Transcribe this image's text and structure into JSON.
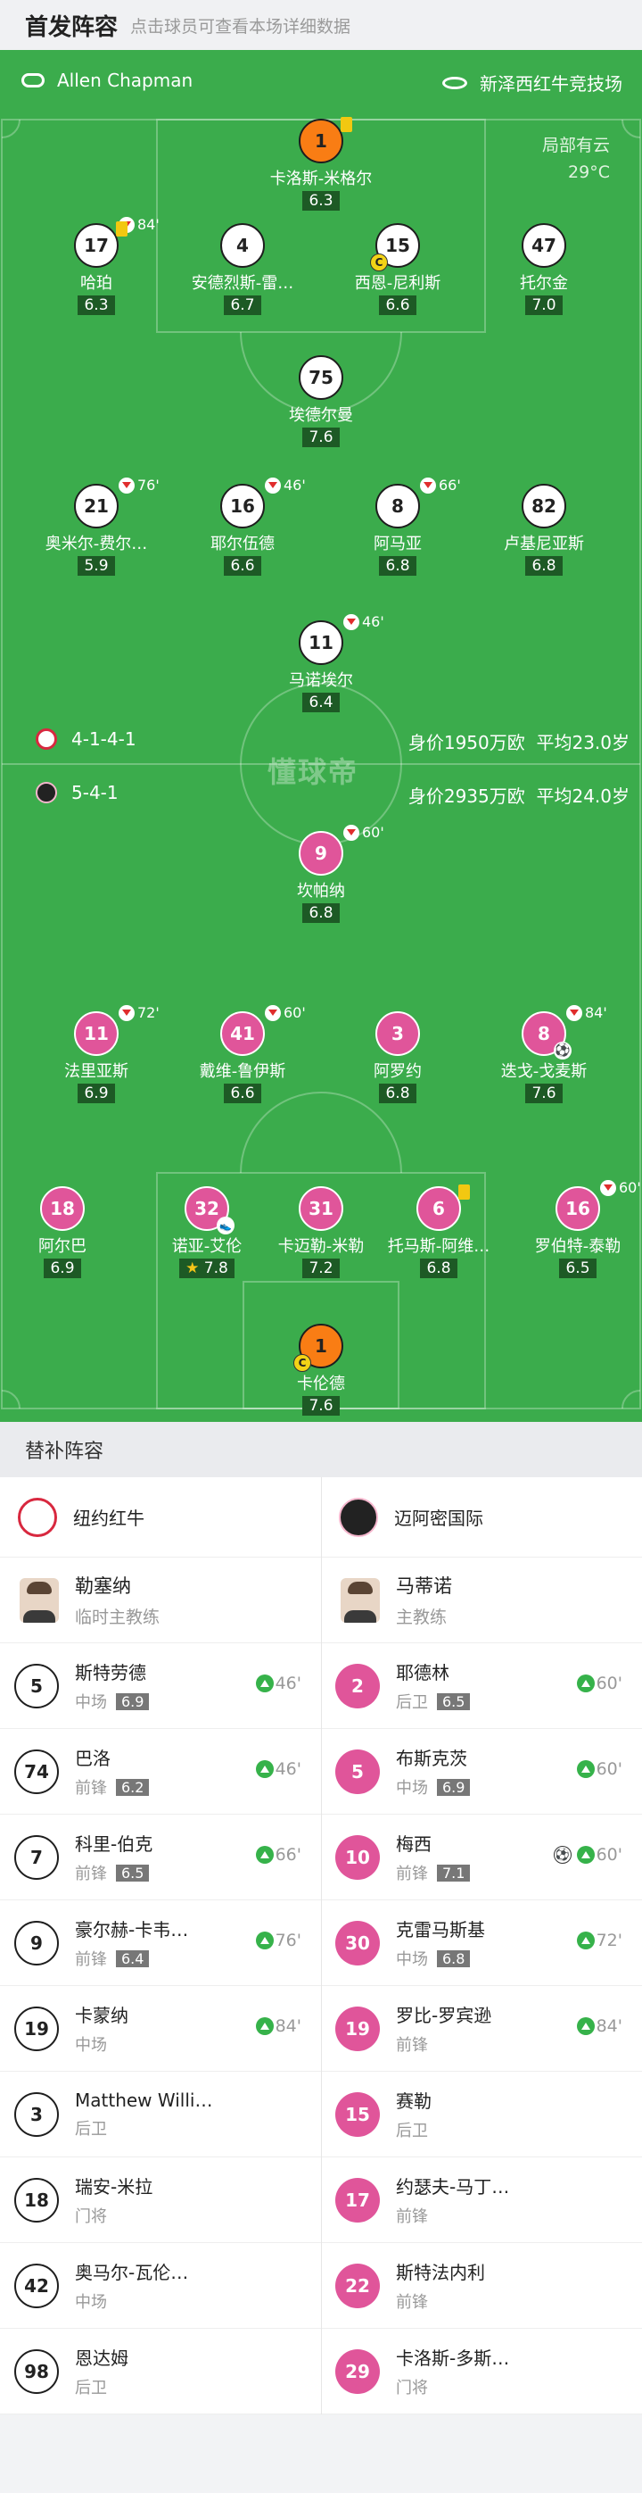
{
  "header": {
    "title": "首发阵容",
    "hint": "点击球员可查看本场详细数据"
  },
  "match": {
    "referee": "Allen Chapman",
    "venue": "新泽西红牛竞技场",
    "weather": "局部有云",
    "temperature": "29°C",
    "watermark": "懂球帝"
  },
  "teams": {
    "home": {
      "name": "纽约红牛",
      "formation": "4-1-4-1",
      "value": "身价1950万欧",
      "avg_age": "平均23.0岁",
      "color": "#ffffff"
    },
    "away": {
      "name": "迈阿密国际",
      "formation": "5-4-1",
      "value": "身价2935万欧",
      "avg_age": "平均24.0岁",
      "color": "#e0559a"
    }
  },
  "home_players": [
    {
      "num": "1",
      "name": "卡洛斯-米格尔",
      "rating": "6.3",
      "style": "o",
      "yellow": true
    },
    {
      "num": "17",
      "name": "哈珀",
      "rating": "6.3",
      "style": "w",
      "yellow": true,
      "sub_out": "84'"
    },
    {
      "num": "4",
      "name": "安德烈斯-雷…",
      "rating": "6.7",
      "style": "w"
    },
    {
      "num": "15",
      "name": "西恩-尼利斯",
      "rating": "6.6",
      "style": "w",
      "captain": true
    },
    {
      "num": "47",
      "name": "托尔金",
      "rating": "7.0",
      "style": "w"
    },
    {
      "num": "75",
      "name": "埃德尔曼",
      "rating": "7.6",
      "style": "w"
    },
    {
      "num": "21",
      "name": "奥米尔-费尔…",
      "rating": "5.9",
      "style": "w",
      "sub_out": "76'"
    },
    {
      "num": "16",
      "name": "耶尔伍德",
      "rating": "6.6",
      "style": "w",
      "sub_out": "46'"
    },
    {
      "num": "8",
      "name": "阿马亚",
      "rating": "6.8",
      "style": "w",
      "sub_out": "66'"
    },
    {
      "num": "82",
      "name": "卢基尼亚斯",
      "rating": "6.8",
      "style": "w"
    },
    {
      "num": "11",
      "name": "马诺埃尔",
      "rating": "6.4",
      "style": "w",
      "sub_out": "46'"
    }
  ],
  "away_players": [
    {
      "num": "9",
      "name": "坎帕纳",
      "rating": "6.8",
      "style": "p",
      "sub_out": "60'"
    },
    {
      "num": "11",
      "name": "法里亚斯",
      "rating": "6.9",
      "style": "p",
      "sub_out": "72'"
    },
    {
      "num": "41",
      "name": "戴维-鲁伊斯",
      "rating": "6.6",
      "style": "p",
      "sub_out": "60'"
    },
    {
      "num": "3",
      "name": "阿罗约",
      "rating": "6.8",
      "style": "p"
    },
    {
      "num": "8",
      "name": "迭戈-戈麦斯",
      "rating": "7.6",
      "style": "p",
      "sub_out": "84'",
      "goal": true
    },
    {
      "num": "18",
      "name": "阿尔巴",
      "rating": "6.9",
      "style": "p"
    },
    {
      "num": "32",
      "name": "诺亚-艾伦",
      "rating": "7.8",
      "style": "p",
      "star": true,
      "assist": true
    },
    {
      "num": "31",
      "name": "卡迈勒-米勒",
      "rating": "7.2",
      "style": "p"
    },
    {
      "num": "6",
      "name": "托马斯-阿维…",
      "rating": "6.8",
      "style": "p",
      "yellow": true
    },
    {
      "num": "16",
      "name": "罗伯特-泰勒",
      "rating": "6.5",
      "style": "p",
      "sub_out": "60'"
    },
    {
      "num": "1",
      "name": "卡伦德",
      "rating": "7.6",
      "style": "o",
      "captain": true
    }
  ],
  "subs_title": "替补阵容",
  "home_coach": {
    "name": "勒塞纳",
    "role": "临时主教练"
  },
  "away_coach": {
    "name": "马蒂诺",
    "role": "主教练"
  },
  "home_subs": [
    {
      "num": "5",
      "name": "斯特劳德",
      "pos": "中场",
      "rating": "6.9",
      "in": "46'"
    },
    {
      "num": "74",
      "name": "巴洛",
      "pos": "前锋",
      "rating": "6.2",
      "in": "46'"
    },
    {
      "num": "7",
      "name": "科里-伯克",
      "pos": "前锋",
      "rating": "6.5",
      "in": "66'"
    },
    {
      "num": "9",
      "name": "豪尔赫-卡韦…",
      "pos": "前锋",
      "rating": "6.4",
      "in": "76'"
    },
    {
      "num": "19",
      "name": "卡蒙纳",
      "pos": "中场",
      "in": "84'"
    },
    {
      "num": "3",
      "name": "Matthew Willi…",
      "pos": "后卫"
    },
    {
      "num": "18",
      "name": "瑞安-米拉",
      "pos": "门将"
    },
    {
      "num": "42",
      "name": "奥马尔-瓦伦…",
      "pos": "中场"
    },
    {
      "num": "98",
      "name": "恩达姆",
      "pos": "后卫"
    }
  ],
  "away_subs": [
    {
      "num": "2",
      "name": "耶德林",
      "pos": "后卫",
      "rating": "6.5",
      "in": "60'"
    },
    {
      "num": "5",
      "name": "布斯克茨",
      "pos": "中场",
      "rating": "6.9",
      "in": "60'"
    },
    {
      "num": "10",
      "name": "梅西",
      "pos": "前锋",
      "rating": "7.1",
      "in": "60'",
      "goal": true
    },
    {
      "num": "30",
      "name": "克雷马斯基",
      "pos": "中场",
      "rating": "6.8",
      "in": "72'"
    },
    {
      "num": "19",
      "name": "罗比-罗宾逊",
      "pos": "前锋",
      "in": "84'"
    },
    {
      "num": "15",
      "name": "赛勒",
      "pos": "后卫"
    },
    {
      "num": "17",
      "name": "约瑟夫-马丁…",
      "pos": "前锋"
    },
    {
      "num": "22",
      "name": "斯特法内利",
      "pos": "前锋"
    },
    {
      "num": "29",
      "name": "卡洛斯-多斯…",
      "pos": "门将"
    }
  ]
}
